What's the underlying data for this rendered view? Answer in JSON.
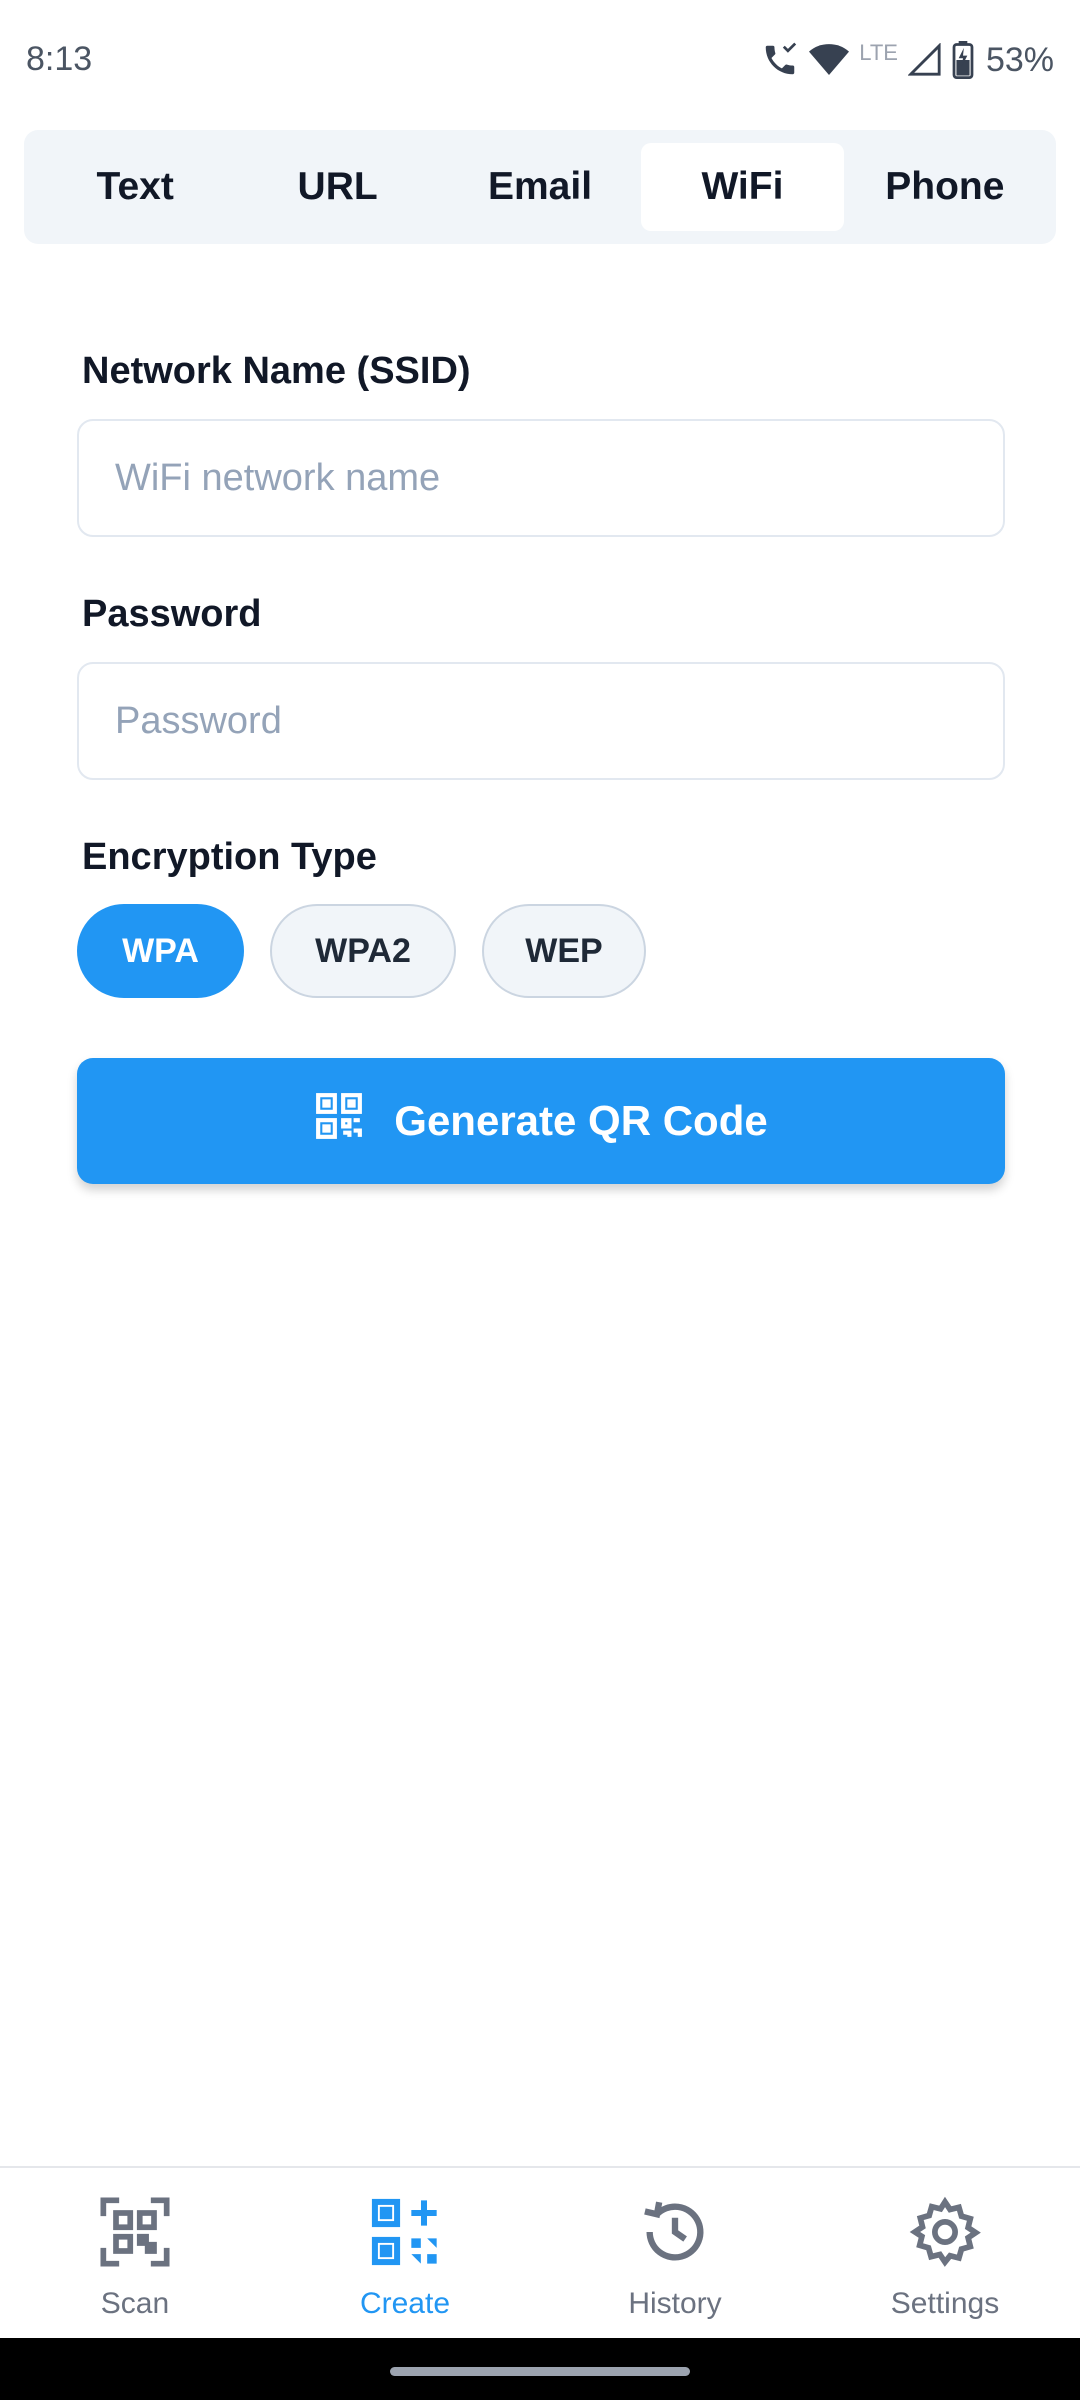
{
  "status_bar": {
    "time": "8:13",
    "network_label": "LTE",
    "battery_percent": "53%"
  },
  "tabs": [
    {
      "label": "Text",
      "active": false
    },
    {
      "label": "URL",
      "active": false
    },
    {
      "label": "Email",
      "active": false
    },
    {
      "label": "WiFi",
      "active": true
    },
    {
      "label": "Phone",
      "active": false
    }
  ],
  "form": {
    "ssid_label": "Network Name (SSID)",
    "ssid_value": "",
    "ssid_placeholder": "WiFi network name",
    "password_label": "Password",
    "password_value": "",
    "password_placeholder": "Password",
    "encryption_label": "Encryption Type",
    "encryption_options": [
      "WPA",
      "WPA2",
      "WEP"
    ],
    "encryption_selected": "WPA",
    "generate_label": "Generate QR Code"
  },
  "bottom_nav": {
    "items": [
      {
        "label": "Scan",
        "icon": "qr-scan-icon",
        "active": false
      },
      {
        "label": "Create",
        "icon": "qr-create-icon",
        "active": true
      },
      {
        "label": "History",
        "icon": "history-icon",
        "active": false
      },
      {
        "label": "Settings",
        "icon": "gear-icon",
        "active": false
      }
    ]
  },
  "colors": {
    "accent": "#2196f3",
    "tab_bg": "#f1f5f9",
    "text_dark": "#111827",
    "placeholder": "#94a3b8",
    "nav_inactive": "#6b7280"
  }
}
